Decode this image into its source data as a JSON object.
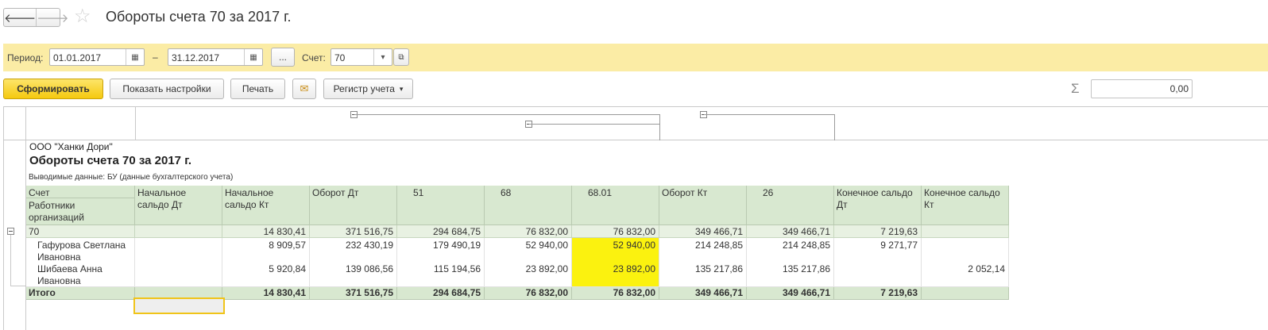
{
  "window": {
    "title": "Обороты счета 70 за 2017 г."
  },
  "nav": {
    "back": "🡐",
    "forward": "🡒",
    "star": "☆"
  },
  "params": {
    "period_label": "Период:",
    "date_from": "01.01.2017",
    "dash": "–",
    "date_to": "31.12.2017",
    "dots": "...",
    "account_label": "Счет:",
    "account_value": "70"
  },
  "toolbar": {
    "generate": "Сформировать",
    "show_settings": "Показать настройки",
    "print": "Печать",
    "mail": "✉",
    "register": "Регистр учета",
    "sigma": "Σ",
    "sum_value": "0,00"
  },
  "report": {
    "org": "ООО \"Ханки Дори\"",
    "title": "Обороты счета 70 за 2017 г.",
    "output": "Выводимые данные:  БУ (данные бухгалтерского учета)",
    "header": {
      "account": "Счет",
      "employees": "Работники организаций",
      "cols": [
        "Начальное сальдо Дт",
        "Начальное сальдо Кт",
        "Оборот Дт",
        "51",
        "68",
        "68.01",
        "Оборот Кт",
        "26",
        "Конечное сальдо Дт",
        "Конечное сальдо Кт"
      ]
    },
    "group_row": {
      "label": "70",
      "values": [
        "",
        "14 830,41",
        "371 516,75",
        "294 684,75",
        "76 832,00",
        "76 832,00",
        "349 466,71",
        "349 466,71",
        "7 219,63",
        ""
      ]
    },
    "rows": [
      {
        "name": "Гафурова Светлана Ивановна",
        "values": [
          "",
          "8 909,57",
          "232 430,19",
          "179 490,19",
          "52 940,00",
          "52 940,00",
          "214 248,85",
          "214 248,85",
          "9 271,77",
          ""
        ]
      },
      {
        "name": "Шибаева Анна Ивановна",
        "values": [
          "",
          "5 920,84",
          "139 086,56",
          "115 194,56",
          "23 892,00",
          "23 892,00",
          "135 217,86",
          "135 217,86",
          "",
          "2 052,14"
        ]
      }
    ],
    "total_row": {
      "label": "Итого",
      "values": [
        "",
        "14 830,41",
        "371 516,75",
        "294 684,75",
        "76 832,00",
        "76 832,00",
        "349 466,71",
        "349 466,71",
        "7 219,63",
        ""
      ]
    }
  },
  "colors": {
    "params_bg": "#fbeca5",
    "header_bg": "#d8e8d0",
    "highlight": "#fbf20f",
    "primary_btn": "#f5c90f"
  }
}
